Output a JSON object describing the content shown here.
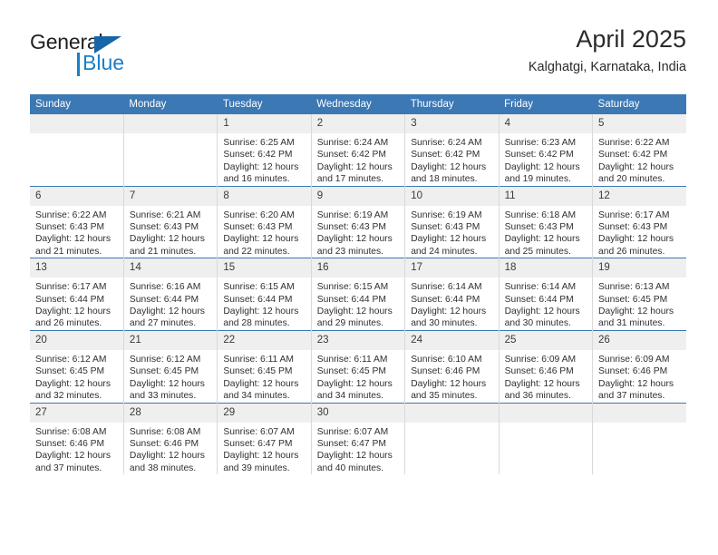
{
  "brand": {
    "name_part1": "General",
    "name_part2": "Blue",
    "triangle_icon": "triangle-icon",
    "accent_color": "#1a7ec8",
    "dark_color": "#231f20"
  },
  "header": {
    "month_title": "April 2025",
    "location": "Kalghatgi, Karnataka, India"
  },
  "calendar": {
    "header_color": "#3b78b4",
    "daynum_bg": "#efefef",
    "weekdays": [
      "Sunday",
      "Monday",
      "Tuesday",
      "Wednesday",
      "Thursday",
      "Friday",
      "Saturday"
    ],
    "weeks": [
      [
        {
          "day": "",
          "sunrise": "",
          "sunset": "",
          "daylight": ""
        },
        {
          "day": "",
          "sunrise": "",
          "sunset": "",
          "daylight": ""
        },
        {
          "day": "1",
          "sunrise": "Sunrise: 6:25 AM",
          "sunset": "Sunset: 6:42 PM",
          "daylight": "Daylight: 12 hours and 16 minutes."
        },
        {
          "day": "2",
          "sunrise": "Sunrise: 6:24 AM",
          "sunset": "Sunset: 6:42 PM",
          "daylight": "Daylight: 12 hours and 17 minutes."
        },
        {
          "day": "3",
          "sunrise": "Sunrise: 6:24 AM",
          "sunset": "Sunset: 6:42 PM",
          "daylight": "Daylight: 12 hours and 18 minutes."
        },
        {
          "day": "4",
          "sunrise": "Sunrise: 6:23 AM",
          "sunset": "Sunset: 6:42 PM",
          "daylight": "Daylight: 12 hours and 19 minutes."
        },
        {
          "day": "5",
          "sunrise": "Sunrise: 6:22 AM",
          "sunset": "Sunset: 6:42 PM",
          "daylight": "Daylight: 12 hours and 20 minutes."
        }
      ],
      [
        {
          "day": "6",
          "sunrise": "Sunrise: 6:22 AM",
          "sunset": "Sunset: 6:43 PM",
          "daylight": "Daylight: 12 hours and 21 minutes."
        },
        {
          "day": "7",
          "sunrise": "Sunrise: 6:21 AM",
          "sunset": "Sunset: 6:43 PM",
          "daylight": "Daylight: 12 hours and 21 minutes."
        },
        {
          "day": "8",
          "sunrise": "Sunrise: 6:20 AM",
          "sunset": "Sunset: 6:43 PM",
          "daylight": "Daylight: 12 hours and 22 minutes."
        },
        {
          "day": "9",
          "sunrise": "Sunrise: 6:19 AM",
          "sunset": "Sunset: 6:43 PM",
          "daylight": "Daylight: 12 hours and 23 minutes."
        },
        {
          "day": "10",
          "sunrise": "Sunrise: 6:19 AM",
          "sunset": "Sunset: 6:43 PM",
          "daylight": "Daylight: 12 hours and 24 minutes."
        },
        {
          "day": "11",
          "sunrise": "Sunrise: 6:18 AM",
          "sunset": "Sunset: 6:43 PM",
          "daylight": "Daylight: 12 hours and 25 minutes."
        },
        {
          "day": "12",
          "sunrise": "Sunrise: 6:17 AM",
          "sunset": "Sunset: 6:43 PM",
          "daylight": "Daylight: 12 hours and 26 minutes."
        }
      ],
      [
        {
          "day": "13",
          "sunrise": "Sunrise: 6:17 AM",
          "sunset": "Sunset: 6:44 PM",
          "daylight": "Daylight: 12 hours and 26 minutes."
        },
        {
          "day": "14",
          "sunrise": "Sunrise: 6:16 AM",
          "sunset": "Sunset: 6:44 PM",
          "daylight": "Daylight: 12 hours and 27 minutes."
        },
        {
          "day": "15",
          "sunrise": "Sunrise: 6:15 AM",
          "sunset": "Sunset: 6:44 PM",
          "daylight": "Daylight: 12 hours and 28 minutes."
        },
        {
          "day": "16",
          "sunrise": "Sunrise: 6:15 AM",
          "sunset": "Sunset: 6:44 PM",
          "daylight": "Daylight: 12 hours and 29 minutes."
        },
        {
          "day": "17",
          "sunrise": "Sunrise: 6:14 AM",
          "sunset": "Sunset: 6:44 PM",
          "daylight": "Daylight: 12 hours and 30 minutes."
        },
        {
          "day": "18",
          "sunrise": "Sunrise: 6:14 AM",
          "sunset": "Sunset: 6:44 PM",
          "daylight": "Daylight: 12 hours and 30 minutes."
        },
        {
          "day": "19",
          "sunrise": "Sunrise: 6:13 AM",
          "sunset": "Sunset: 6:45 PM",
          "daylight": "Daylight: 12 hours and 31 minutes."
        }
      ],
      [
        {
          "day": "20",
          "sunrise": "Sunrise: 6:12 AM",
          "sunset": "Sunset: 6:45 PM",
          "daylight": "Daylight: 12 hours and 32 minutes."
        },
        {
          "day": "21",
          "sunrise": "Sunrise: 6:12 AM",
          "sunset": "Sunset: 6:45 PM",
          "daylight": "Daylight: 12 hours and 33 minutes."
        },
        {
          "day": "22",
          "sunrise": "Sunrise: 6:11 AM",
          "sunset": "Sunset: 6:45 PM",
          "daylight": "Daylight: 12 hours and 34 minutes."
        },
        {
          "day": "23",
          "sunrise": "Sunrise: 6:11 AM",
          "sunset": "Sunset: 6:45 PM",
          "daylight": "Daylight: 12 hours and 34 minutes."
        },
        {
          "day": "24",
          "sunrise": "Sunrise: 6:10 AM",
          "sunset": "Sunset: 6:46 PM",
          "daylight": "Daylight: 12 hours and 35 minutes."
        },
        {
          "day": "25",
          "sunrise": "Sunrise: 6:09 AM",
          "sunset": "Sunset: 6:46 PM",
          "daylight": "Daylight: 12 hours and 36 minutes."
        },
        {
          "day": "26",
          "sunrise": "Sunrise: 6:09 AM",
          "sunset": "Sunset: 6:46 PM",
          "daylight": "Daylight: 12 hours and 37 minutes."
        }
      ],
      [
        {
          "day": "27",
          "sunrise": "Sunrise: 6:08 AM",
          "sunset": "Sunset: 6:46 PM",
          "daylight": "Daylight: 12 hours and 37 minutes."
        },
        {
          "day": "28",
          "sunrise": "Sunrise: 6:08 AM",
          "sunset": "Sunset: 6:46 PM",
          "daylight": "Daylight: 12 hours and 38 minutes."
        },
        {
          "day": "29",
          "sunrise": "Sunrise: 6:07 AM",
          "sunset": "Sunset: 6:47 PM",
          "daylight": "Daylight: 12 hours and 39 minutes."
        },
        {
          "day": "30",
          "sunrise": "Sunrise: 6:07 AM",
          "sunset": "Sunset: 6:47 PM",
          "daylight": "Daylight: 12 hours and 40 minutes."
        },
        {
          "day": "",
          "sunrise": "",
          "sunset": "",
          "daylight": ""
        },
        {
          "day": "",
          "sunrise": "",
          "sunset": "",
          "daylight": ""
        },
        {
          "day": "",
          "sunrise": "",
          "sunset": "",
          "daylight": ""
        }
      ]
    ]
  }
}
